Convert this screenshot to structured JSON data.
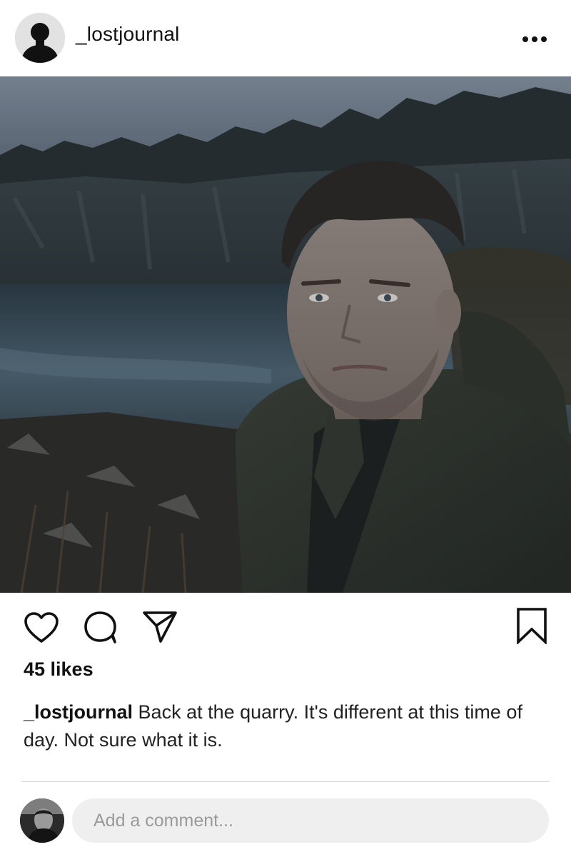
{
  "post": {
    "username": "_lostjournal",
    "likes_text": "45 likes",
    "caption": {
      "username": "_lostjournal",
      "text": "Back at the quarry. It's different at this time of day. Not sure what it is."
    }
  },
  "icons": {
    "more": "more-options-icon",
    "like": "heart-icon",
    "comment": "comment-bubble-icon",
    "share": "send-icon",
    "save": "bookmark-icon"
  },
  "comment_box": {
    "placeholder": "Add a comment..."
  }
}
